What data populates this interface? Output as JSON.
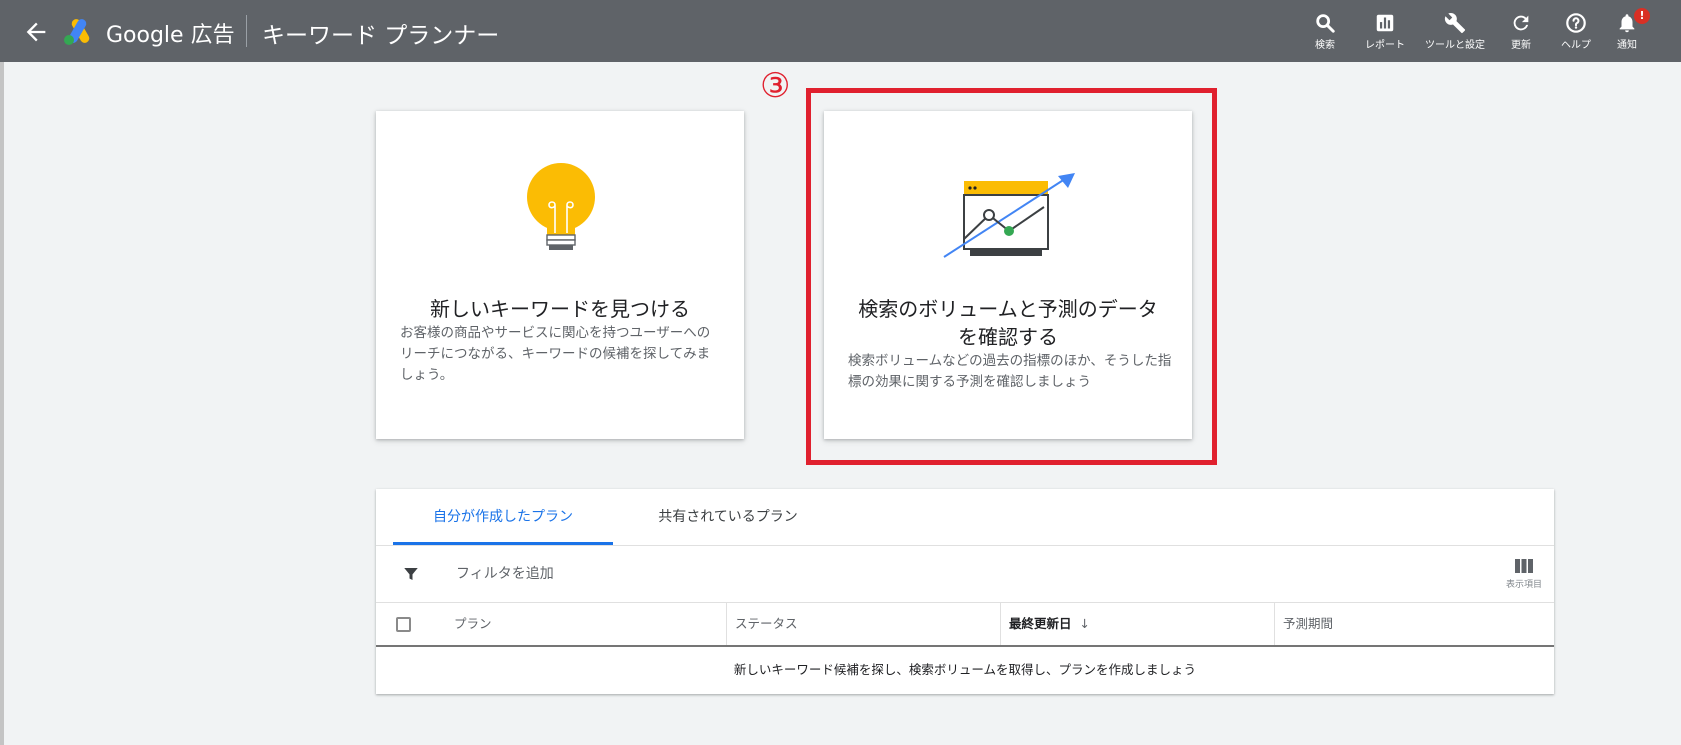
{
  "header": {
    "brand": "Google 広告",
    "title": "キーワード プランナー",
    "actions": [
      {
        "label": "検索",
        "icon": "search-icon"
      },
      {
        "label": "レポート",
        "icon": "reports-icon"
      },
      {
        "label": "ツールと設定",
        "icon": "wrench-icon"
      },
      {
        "label": "更新",
        "icon": "refresh-icon"
      },
      {
        "label": "ヘルプ",
        "icon": "help-icon"
      },
      {
        "label": "通知",
        "icon": "bell-icon",
        "badge": "!"
      }
    ]
  },
  "annotation": {
    "step": "③",
    "highlight_color": "#e0202e"
  },
  "cards": [
    {
      "title": "新しいキーワードを見つける",
      "description": "お客様の商品やサービスに関心を持つユーザーへのリーチにつながる、キーワードの候補を探してみましょう。",
      "icon": "lightbulb-icon"
    },
    {
      "title": "検索のボリュームと予測のデータを確認する",
      "description": "検索ボリュームなどの過去の指標のほか、そうした指標の効果に関する予測を確認しましょう",
      "icon": "forecast-chart-icon"
    }
  ],
  "plans": {
    "tabs": [
      "自分が作成したプラン",
      "共有されているプラン"
    ],
    "active_tab": 0,
    "filter_label": "フィルタを追加",
    "columns_label": "表示項目",
    "headers": [
      "プラン",
      "ステータス",
      "最終更新日",
      "予測期間"
    ],
    "sorted_column": "最終更新日",
    "empty_message": "新しいキーワード候補を探し、検索ボリュームを取得し、プランを作成しましょう"
  },
  "colors": {
    "topbar": "#5f6368",
    "accent": "#1a73e8",
    "bulb": "#fbbc04",
    "highlight": "#e0202e"
  }
}
